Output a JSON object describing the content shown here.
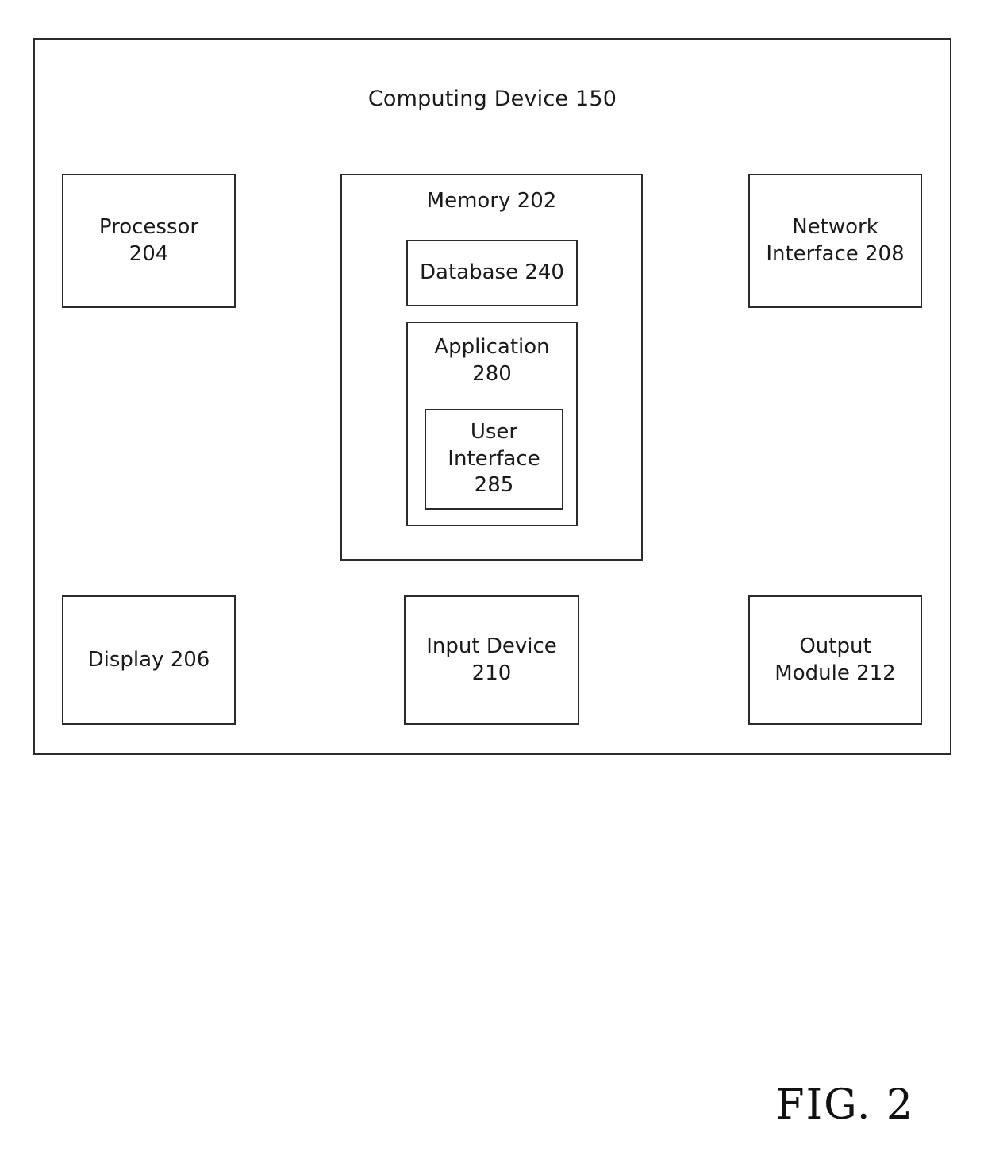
{
  "figure": {
    "caption": "FIG. 2",
    "frame_title": "Computing Device 150"
  },
  "diagram": {
    "type": "block-diagram",
    "root": "Computing Device 150",
    "blocks": [
      {
        "id": "processor",
        "label": "Processor\n204",
        "parent": "computing-device"
      },
      {
        "id": "memory",
        "label": "Memory 202",
        "parent": "computing-device"
      },
      {
        "id": "network",
        "label": "Network\nInterface 208",
        "parent": "computing-device"
      },
      {
        "id": "database",
        "label": "Database 240",
        "parent": "memory"
      },
      {
        "id": "application",
        "label": "Application\n280",
        "parent": "memory"
      },
      {
        "id": "userinterface",
        "label": "User\nInterface\n285",
        "parent": "application"
      },
      {
        "id": "display",
        "label": "Display 206",
        "parent": "computing-device"
      },
      {
        "id": "input",
        "label": "Input Device\n210",
        "parent": "computing-device"
      },
      {
        "id": "output",
        "label": "Output\nModule 212",
        "parent": "computing-device"
      }
    ]
  },
  "labels": {
    "processor": "Processor\n204",
    "memory": "Memory 202",
    "network_interface": "Network\nInterface 208",
    "database": "Database 240",
    "application": "Application\n280",
    "user_interface": "User\nInterface\n285",
    "display": "Display 206",
    "input_device": "Input Device\n210",
    "output_module": "Output\nModule 212"
  },
  "colors": {
    "stroke": "#2b2b2b",
    "background": "#ffffff",
    "text": "#1a1a1a"
  }
}
